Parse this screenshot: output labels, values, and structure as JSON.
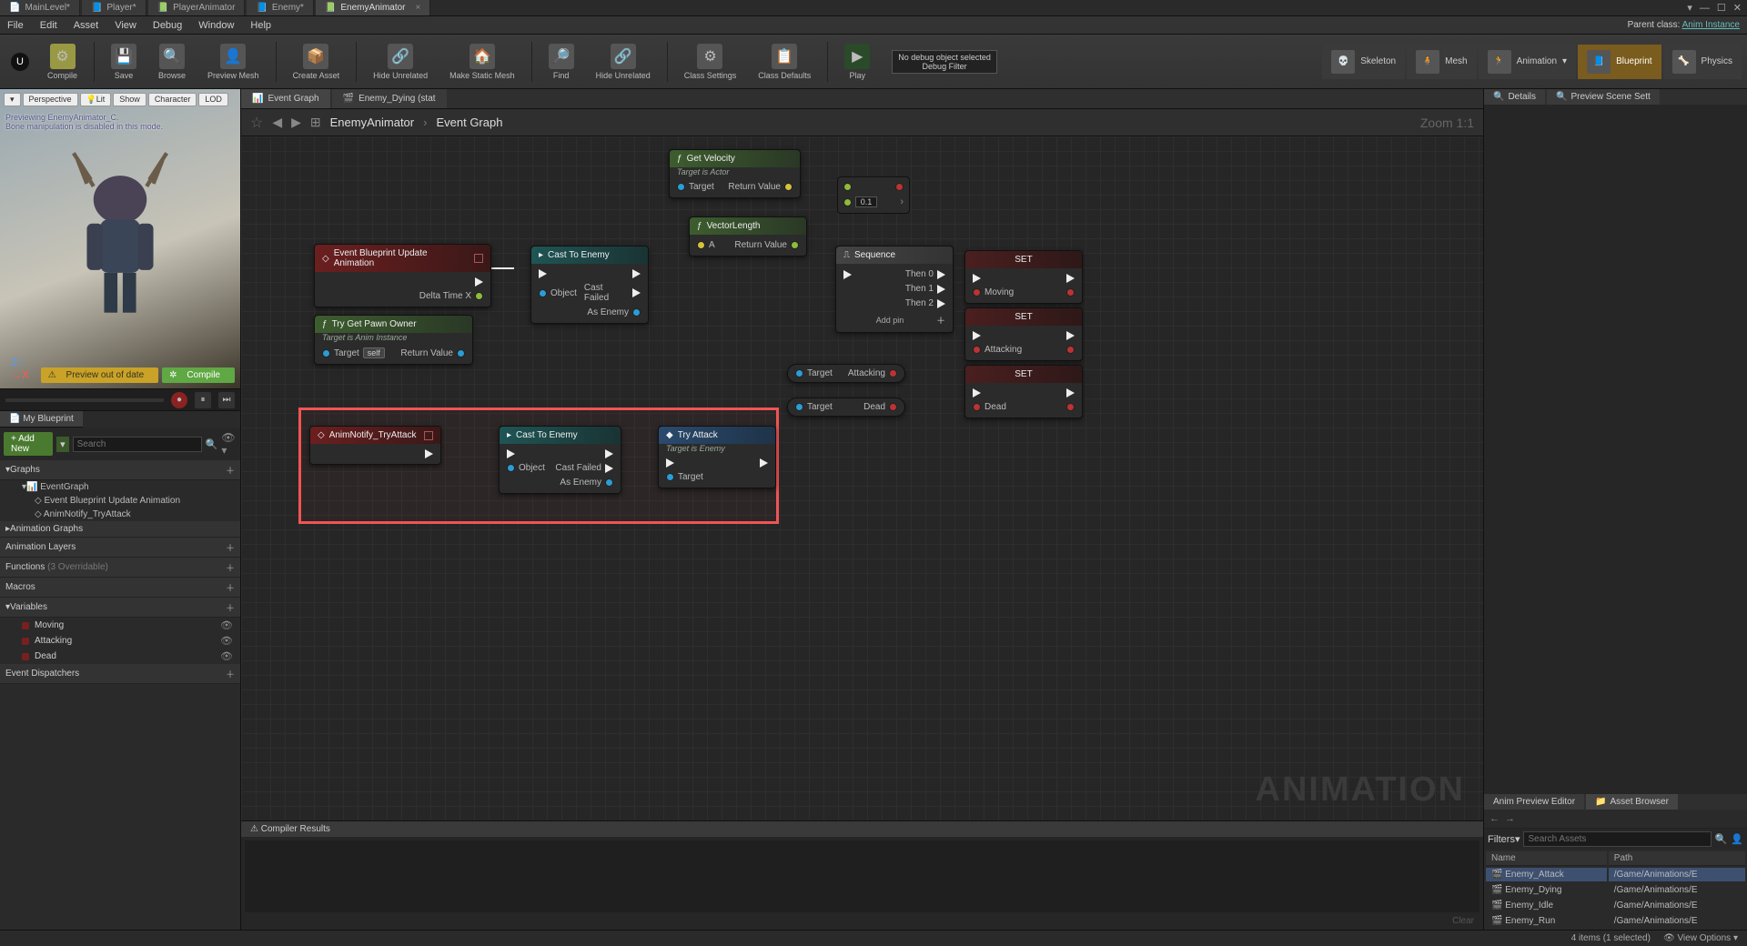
{
  "topTabs": [
    "MainLevel*",
    "Player*",
    "PlayerAnimator",
    "Enemy*",
    "EnemyAnimator"
  ],
  "activeTopTab": 4,
  "menu": [
    "File",
    "Edit",
    "Asset",
    "View",
    "Debug",
    "Window",
    "Help"
  ],
  "parentClassLabel": "Parent class:",
  "parentClass": "Anim Instance",
  "toolbar": {
    "compile": "Compile",
    "save": "Save",
    "browse": "Browse",
    "previewMesh": "Preview Mesh",
    "createAsset": "Create Asset",
    "hideUnrelated1": "Hide Unrelated",
    "makeStaticMesh": "Make Static Mesh",
    "find": "Find",
    "hideUnrelated2": "Hide Unrelated",
    "classSettings": "Class Settings",
    "classDefaults": "Class Defaults",
    "play": "Play",
    "debugObj": "No debug object selected",
    "debugFilter": "Debug Filter"
  },
  "modes": {
    "skeleton": "Skeleton",
    "mesh": "Mesh",
    "animation": "Animation",
    "blueprint": "Blueprint",
    "physics": "Physics"
  },
  "viewport": {
    "buttons": [
      "Perspective",
      "Lit",
      "Show",
      "Character",
      "LOD"
    ],
    "msg1": "Previewing EnemyAnimator_C.",
    "msg2": "Bone manipulation is disabled in this mode.",
    "previewOut": "Preview out of date",
    "compile": "Compile"
  },
  "myBlueprint": {
    "title": "My Blueprint",
    "addNew": "+ Add New",
    "searchPH": "Search",
    "sections": {
      "graphs": "Graphs",
      "eventGraph": "EventGraph",
      "evt1": "Event Blueprint Update Animation",
      "evt2": "AnimNotify_TryAttack",
      "animGraphs": "Animation Graphs",
      "animLayers": "Animation Layers",
      "functions": "Functions",
      "funcSub": "(3 Overridable)",
      "macros": "Macros",
      "variables": "Variables",
      "dispatchers": "Event Dispatchers"
    },
    "vars": [
      "Moving",
      "Attacking",
      "Dead"
    ]
  },
  "graphTabs": {
    "eventGraph": "Event Graph",
    "enemyDying": "Enemy_Dying (stat"
  },
  "breadcrumb": {
    "a": "EnemyAnimator",
    "b": "Event Graph",
    "zoom": "Zoom 1:1"
  },
  "nodes": {
    "eventUpdate": "Event Blueprint Update Animation",
    "deltaTime": "Delta Time X",
    "tryGetPawn": "Try Get Pawn Owner",
    "tryGetPawnSub": "Target is Anim Instance",
    "target": "Target",
    "returnValue": "Return Value",
    "self": "self",
    "castEnemy": "Cast To Enemy",
    "object": "Object",
    "castFailed": "Cast Failed",
    "asEnemy": "As Enemy",
    "getVelocity": "Get Velocity",
    "getVelocitySub": "Target is Actor",
    "vectorLength": "VectorLength",
    "a": "A",
    "sequence": "Sequence",
    "then0": "Then 0",
    "then1": "Then 1",
    "then2": "Then 2",
    "addPin": "Add pin",
    "set": "SET",
    "moving": "Moving",
    "attacking": "Attacking",
    "dead": "Dead",
    "val": "0.1",
    "animNotify": "AnimNotify_TryAttack",
    "tryAttack": "Try Attack",
    "tryAttackSub": "Target is Enemy"
  },
  "compiler": {
    "title": "Compiler Results",
    "clear": "Clear"
  },
  "watermark": "ANIMATION",
  "details": {
    "details": "Details",
    "previewScene": "Preview Scene Sett"
  },
  "assetBrowser": {
    "animPreview": "Anim Preview Editor",
    "assetBrowser": "Asset Browser",
    "filters": "Filters",
    "searchPH": "Search Assets",
    "cols": {
      "name": "Name",
      "path": "Path"
    },
    "rows": [
      {
        "name": "Enemy_Attack",
        "path": "/Game/Animations/E"
      },
      {
        "name": "Enemy_Dying",
        "path": "/Game/Animations/E"
      },
      {
        "name": "Enemy_Idle",
        "path": "/Game/Animations/E"
      },
      {
        "name": "Enemy_Run",
        "path": "/Game/Animations/E"
      }
    ]
  },
  "status": {
    "items": "4 items (1 selected)",
    "viewOpts": "View Options"
  }
}
